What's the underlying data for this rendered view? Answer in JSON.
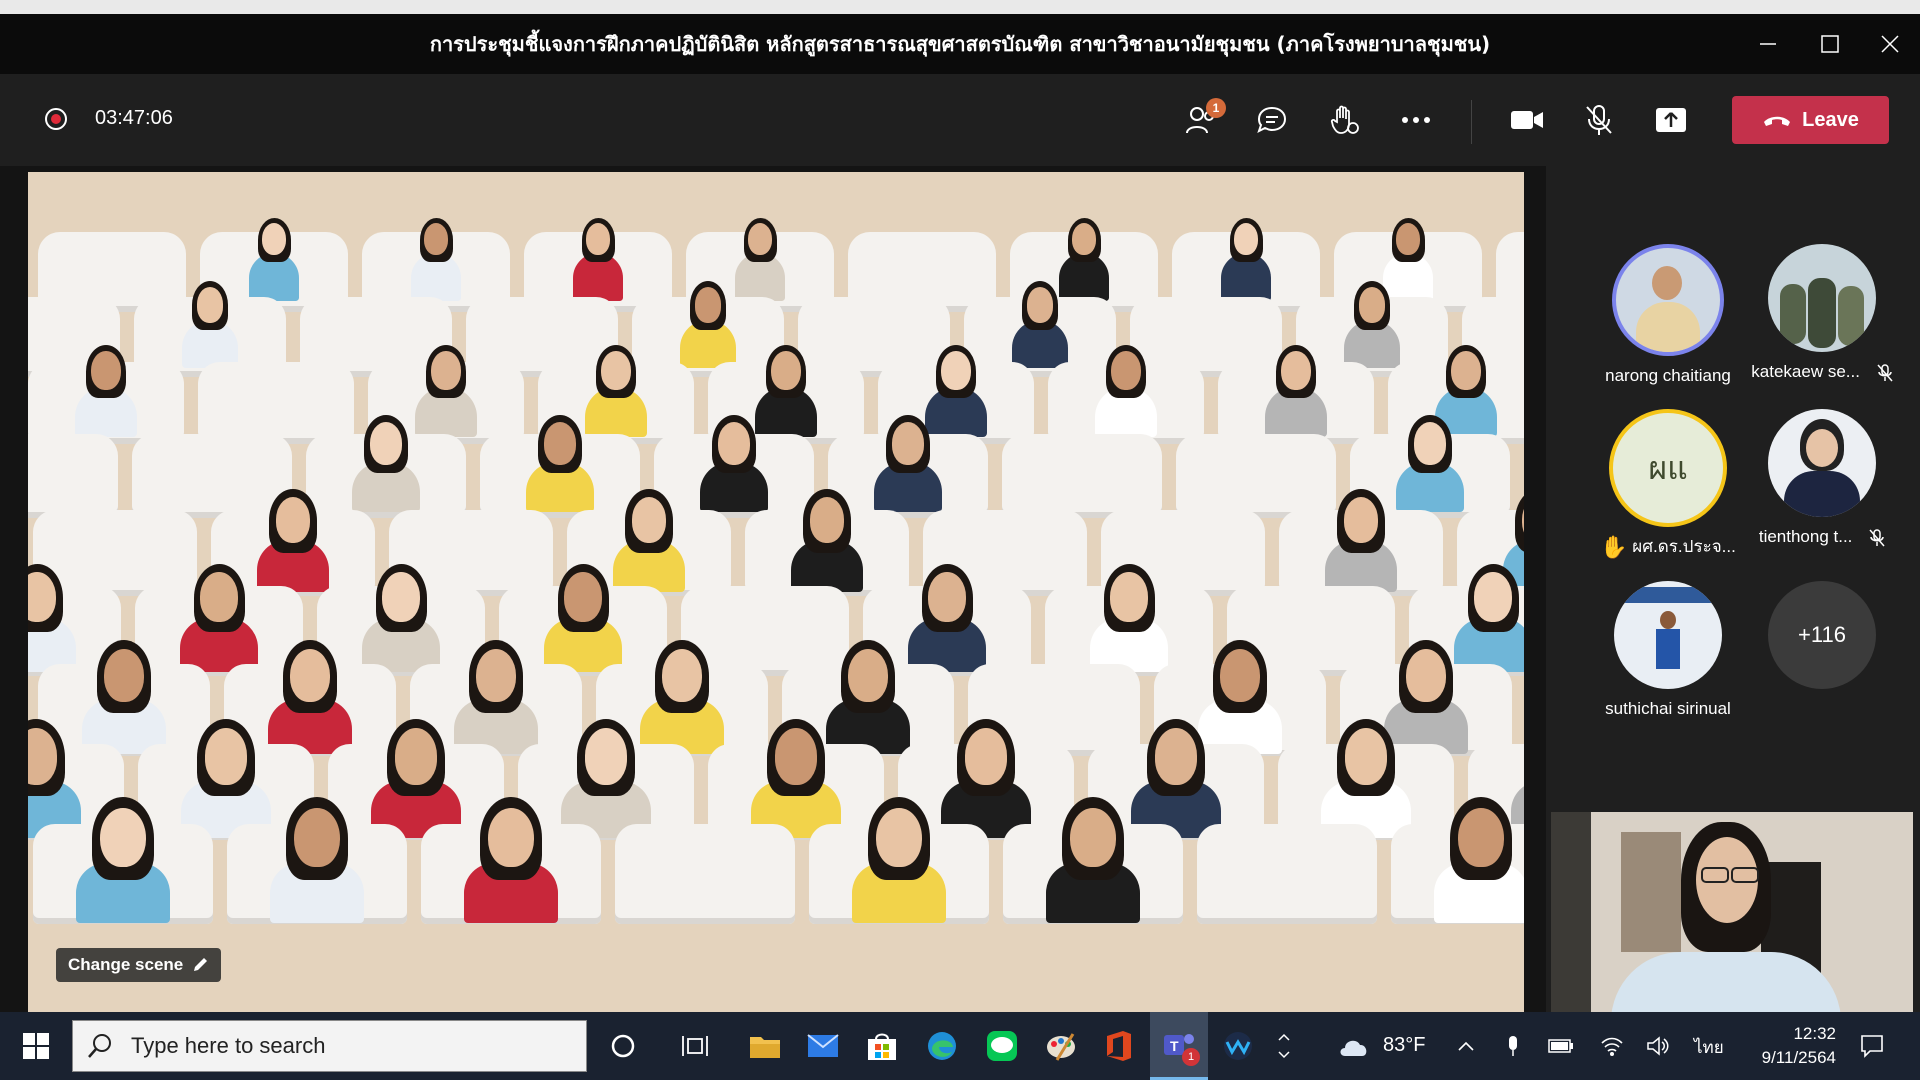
{
  "window": {
    "title": "การประชุมชี้แจงการฝึกภาคปฏิบัตินิสิต หลักสูตรสาธารณสุขศาสตรบัณฑิต สาขาวิชาอนามัยชุมชน (ภาคโรงพยาบาลชุมชน)"
  },
  "toolbar": {
    "timer": "03:47:06",
    "participants_badge": "1",
    "leave_label": "Leave"
  },
  "stage": {
    "change_scene_label": "Change scene"
  },
  "participants": [
    {
      "name": "narong chaitiang",
      "muted": false,
      "raised_hand": false
    },
    {
      "name": "katekaew se...",
      "muted": true,
      "raised_hand": false
    },
    {
      "name": "ผศ.ดร.ประจ...",
      "initials": "ผแ",
      "muted": true,
      "raised_hand": true
    },
    {
      "name": "tienthong t...",
      "muted": true,
      "raised_hand": false
    },
    {
      "name": "suthichai sirinual",
      "muted": false,
      "raised_hand": false
    }
  ],
  "overflow_count": "+116",
  "taskbar": {
    "search_placeholder": "Type here to search",
    "weather": "83°F",
    "language": "ไทย",
    "time": "12:32",
    "date": "9/11/2564",
    "teams_badge": "1"
  },
  "colors": {
    "leave": "#c4314b",
    "record": "#e02b3a",
    "active_speaker_ring": "#7b83eb",
    "raised_ring": "#f5c518"
  }
}
